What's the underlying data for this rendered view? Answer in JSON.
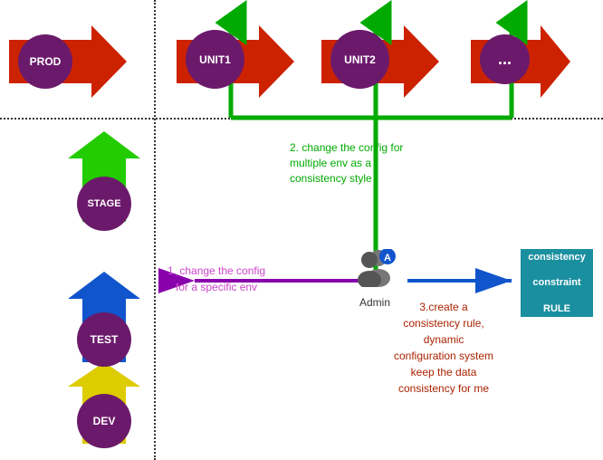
{
  "environments": {
    "prod": {
      "label": "PROD"
    },
    "unit1": {
      "label": "UNIT1"
    },
    "unit2": {
      "label": "UNIT2"
    },
    "dots": {
      "label": "..."
    },
    "stage": {
      "label": "STAGE"
    },
    "test": {
      "label": "TEST"
    },
    "dev": {
      "label": "DEV"
    }
  },
  "labels": {
    "admin": "Admin",
    "step1": "1. change the config\nfor a specific env",
    "step1_line1": "1. change the config",
    "step1_line2": "for a specific env",
    "step2_line1": "2. change the config for",
    "step2_line2": "multiple env as a",
    "step2_line3": "consistency style",
    "step3_line1": "3.create a",
    "step3_line2": "consistency rule,",
    "step3_line3": "dynamic",
    "step3_line4": "configuration system",
    "step3_line5": "keep the data",
    "step3_line6": "consistency for me",
    "constraint_line1": "consistency",
    "constraint_line2": "constraint",
    "constraint_line3": "RULE"
  },
  "colors": {
    "prod_arrow": "#cc2200",
    "purple_circle": "#6b1a6b",
    "green_arrow": "#22cc00",
    "blue_arrow": "#1155cc",
    "yellow_arrow": "#ddcc00",
    "green_up": "#00aa00",
    "constraint_bg": "#1a8fa0",
    "purple_horiz": "#8800aa",
    "blue_horiz": "#1155cc",
    "step1_text": "#cc44cc",
    "step2_text": "#00aa00",
    "step3_text": "#aa2200"
  }
}
